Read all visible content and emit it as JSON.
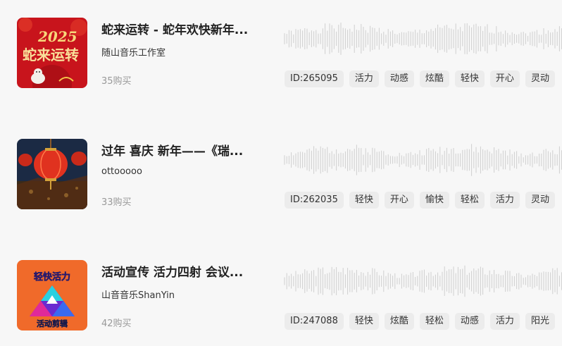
{
  "tracks": [
    {
      "title": "蛇来运转 - 蛇年欢快新年...",
      "author": "随山音乐工作室",
      "sales": "35购买",
      "id_label": "ID:265095",
      "tags": [
        "活力",
        "动感",
        "炫酷",
        "轻快",
        "开心",
        "灵动"
      ],
      "cover": {
        "bg": "#c8141c",
        "year_text": "2025",
        "text": "蛇来运转",
        "icon": "snake-new-year-cover"
      }
    },
    {
      "title": "过年 喜庆 新年——《瑞...",
      "author": "ottooooo",
      "sales": "33购买",
      "id_label": "ID:262035",
      "tags": [
        "轻快",
        "开心",
        "愉快",
        "轻松",
        "活力",
        "灵动"
      ],
      "cover": {
        "bg": "#1b2a44",
        "icon": "red-lanterns-cover"
      }
    },
    {
      "title": "活动宣传 活力四射 会议...",
      "author": "山音音乐ShanYin",
      "sales": "42购买",
      "id_label": "ID:247088",
      "tags": [
        "轻快",
        "炫酷",
        "轻松",
        "动感",
        "活力",
        "阳光"
      ],
      "cover": {
        "bg": "#f06a2a",
        "top_text": "轻快活力",
        "bottom_text": "活动剪辑",
        "icon": "triangle-logo-cover"
      }
    }
  ]
}
